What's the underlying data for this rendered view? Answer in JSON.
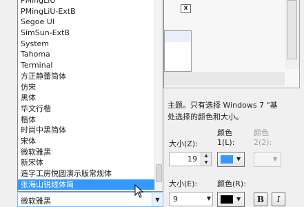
{
  "font_list": {
    "items": [
      "PMingLiU",
      "PMingLiU-ExtB",
      "Segoe UI",
      "SimSun-ExtB",
      "System",
      "Tahoma",
      "Terminal",
      "方正静蕾简体",
      "仿宋",
      "黑体",
      "华文行楷",
      "楷体",
      "时尚中黑简体",
      "宋体",
      "微软雅黑",
      "新宋体",
      "造字工房悦圆演示版常规体",
      "张海山锐线体简"
    ],
    "selected_index": 17
  },
  "font_combo": {
    "value": "微软雅黑",
    "arrow_icon": "chevron-down-icon"
  },
  "preview": {
    "close_glyph": "x"
  },
  "description": {
    "line1": "主题。只有选择 Windows 7 \"基",
    "line2": "处选择的颜色和大小。"
  },
  "item_settings": {
    "size_label": "大小(Z):",
    "size_value": "19",
    "color1_label_top": "颜色",
    "color1_label_bottom": "1(L):",
    "color1_value": "#3399ff",
    "color2_label_top": "颜色",
    "color2_label_bottom": "2(2):"
  },
  "font_settings": {
    "size_label": "大小(E):",
    "size_value": "9",
    "color_label": "颜色(R):",
    "color_value": "#000000",
    "bold_label": "B",
    "italic_label": "I"
  },
  "colors": {
    "selection": "#3399ff",
    "accent": "#3399ff"
  }
}
